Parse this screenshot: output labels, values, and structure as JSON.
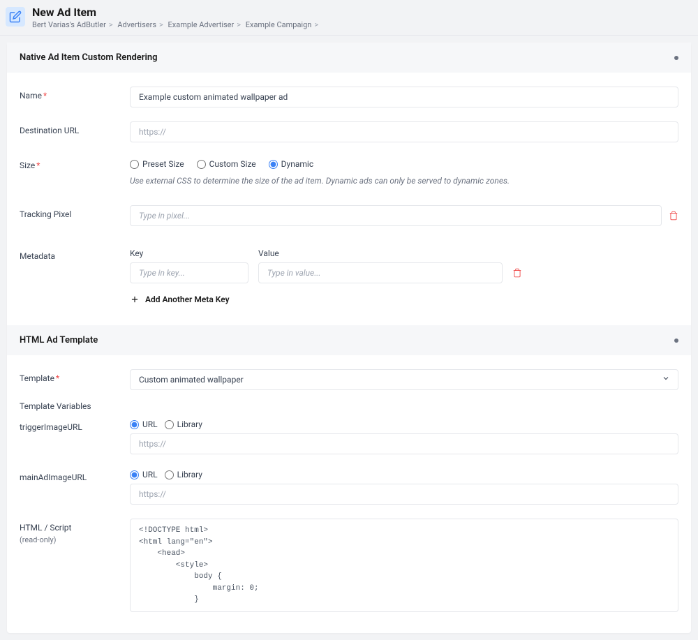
{
  "header": {
    "title": "New Ad Item",
    "breadcrumb": [
      "Bert Varias's AdButler",
      "Advertisers",
      "Example Advertiser",
      "Example Campaign",
      ""
    ]
  },
  "section1": {
    "title": "Native Ad Item Custom Rendering",
    "name_label": "Name",
    "name_value": "Example custom animated wallpaper ad",
    "dest_label": "Destination URL",
    "dest_placeholder": "https://",
    "size_label": "Size",
    "size_options": {
      "preset": "Preset Size",
      "custom": "Custom Size",
      "dynamic": "Dynamic"
    },
    "size_help": "Use external CSS to determine the size of the ad item. Dynamic ads can only be served to dynamic zones.",
    "pixel_label": "Tracking Pixel",
    "pixel_placeholder": "Type in pixel...",
    "meta_label": "Metadata",
    "meta_key": "Key",
    "meta_value": "Value",
    "meta_key_placeholder": "Type in key...",
    "meta_value_placeholder": "Type in value...",
    "add_meta": "Add Another Meta Key"
  },
  "section2": {
    "title": "HTML Ad Template",
    "template_label": "Template",
    "template_value": "Custom animated wallpaper",
    "vars_label": "Template Variables",
    "trigger_label": "triggerImageURL",
    "main_label": "mainAdImageURL",
    "url_opt": "URL",
    "library_opt": "Library",
    "url_placeholder": "https://",
    "html_label": "HTML / Script",
    "html_sub": "(read-only)",
    "html_content": "<!DOCTYPE html>\n<html lang=\"en\">\n    <head>\n        <style>\n            body {\n                margin: 0;\n            }"
  }
}
